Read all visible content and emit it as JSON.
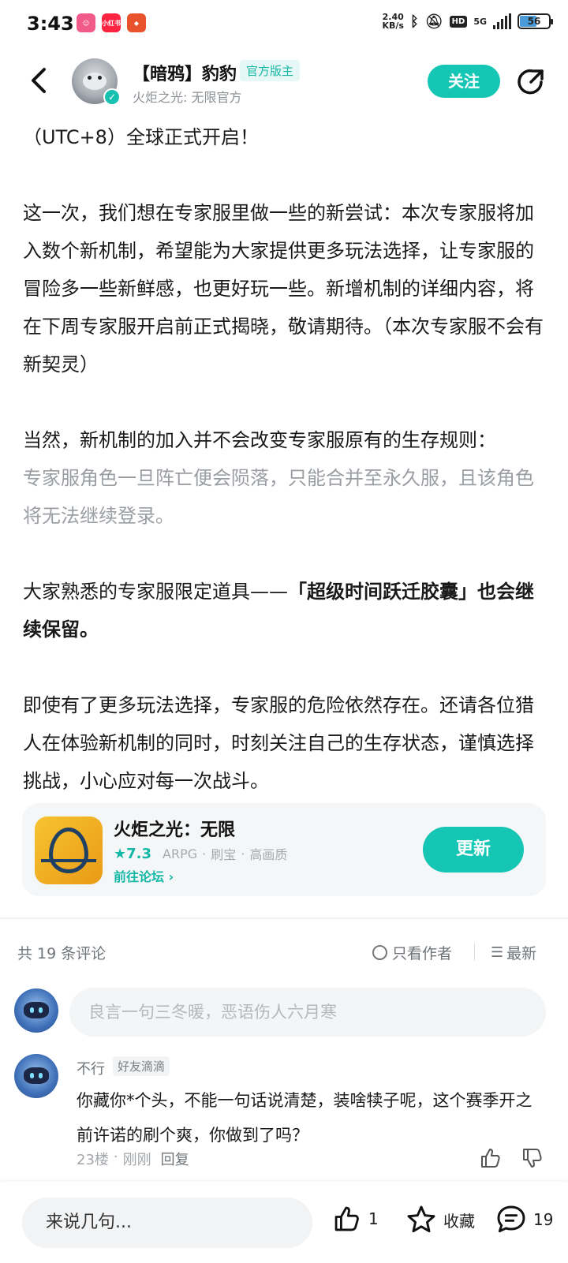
{
  "status_bar": {
    "time": "3:43",
    "net_speed_top": "2.40",
    "net_speed_bottom": "KB/s",
    "network_type": "5G",
    "battery": "56",
    "hd_label": "HD",
    "app_xhs_label": "小红书"
  },
  "header": {
    "author_name": "【暗鸦】豹豹",
    "author_badge": "官方版主",
    "author_subtitle": "火炬之光: 无限官方",
    "follow_label": "关注"
  },
  "article": {
    "paragraphs": [
      "（UTC+8）全球正式开启！",
      "这一次，我们想在专家服里做一些的新尝试：本次专家服将加入数个新机制，希望能为大家提供更多玩法选择，让专家服的冒险多一些新鲜感，也更好玩一些。新增机制的详细内容，将在下周专家服开启前正式揭晓，敬请期待。（本次专家服不会有新契灵）",
      "当然，新机制的加入并不会改变专家服原有的生存规则：",
      "专家服角色一旦阵亡便会陨落，只能合并至永久服，且该角色将无法继续登录。",
      "大家熟悉的专家服限定道具——「超级时间跃迁胶囊」也会继续保留。",
      "即使有了更多玩法选择，专家服的危险依然存在。还请各位猎人在体验新机制的同时，时刻关注自己的生存状态，谨慎选择挑战，小心应对每一次战斗。"
    ],
    "para5_normal": "大家熟悉的专家服限定道具——",
    "para5_bold": "「超级时间跃迁胶囊」也会继续保留。"
  },
  "game_card": {
    "title": "火炬之光：无限",
    "rating": "7.3",
    "tags": [
      "ARPG",
      "刷宝",
      "高画质"
    ],
    "link": "前往论坛",
    "button": "更新"
  },
  "comments": {
    "count_label": "共 19 条评论",
    "author_only_label": "只看作者",
    "sort_label": "最新",
    "input_placeholder": "良言一句三冬暖，恶语伤人六月寒",
    "items": [
      {
        "name": "不行",
        "badge": "好友滴滴",
        "text": "你藏你*个头，不能一句话说清楚，装啥犊子呢，这个赛季开之前许诺的刷个爽，你做到了吗？",
        "floor": "23楼",
        "time": "刚刚",
        "reply": "回复"
      }
    ]
  },
  "bottom_bar": {
    "input_placeholder": "来说几句...",
    "like_count": "1",
    "favorite_label": "收藏",
    "comment_count": "19"
  },
  "colors": {
    "accent": "#16c6b4",
    "text": "#1a1a1a",
    "muted": "#9a9ea3"
  }
}
